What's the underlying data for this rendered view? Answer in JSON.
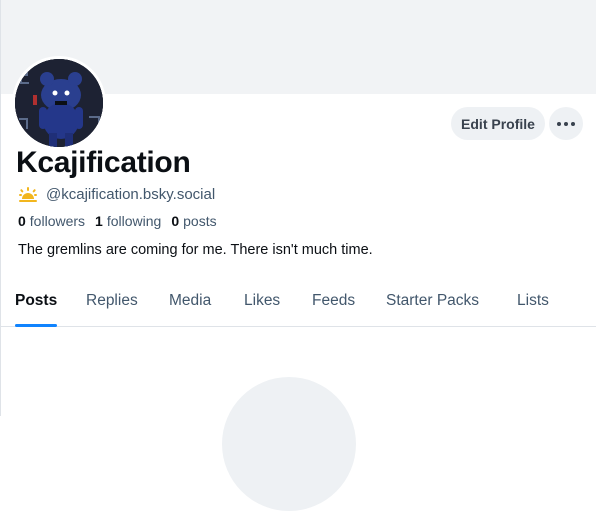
{
  "profile": {
    "display_name": "Kcajification",
    "handle": "@kcajification.bsky.social",
    "bio": "The gremlins are coming for me. There isn't much time.",
    "avatar_icon": "avatar-image",
    "handle_icon": "sunrise-icon"
  },
  "actions": {
    "edit_label": "Edit Profile",
    "more_icon": "more-icon"
  },
  "stats": {
    "followers_count": "0",
    "followers_label": "followers",
    "following_count": "1",
    "following_label": "following",
    "posts_count": "0",
    "posts_label": "posts"
  },
  "tabs": [
    {
      "label": "Posts",
      "active": true
    },
    {
      "label": "Replies",
      "active": false
    },
    {
      "label": "Media",
      "active": false
    },
    {
      "label": "Likes",
      "active": false
    },
    {
      "label": "Feeds",
      "active": false
    },
    {
      "label": "Starter Packs",
      "active": false
    },
    {
      "label": "Lists",
      "active": false
    }
  ],
  "colors": {
    "accent": "#1083fe",
    "banner": "#f1f3f5",
    "muted_text": "#42576c",
    "button_bg": "#eef1f4"
  }
}
